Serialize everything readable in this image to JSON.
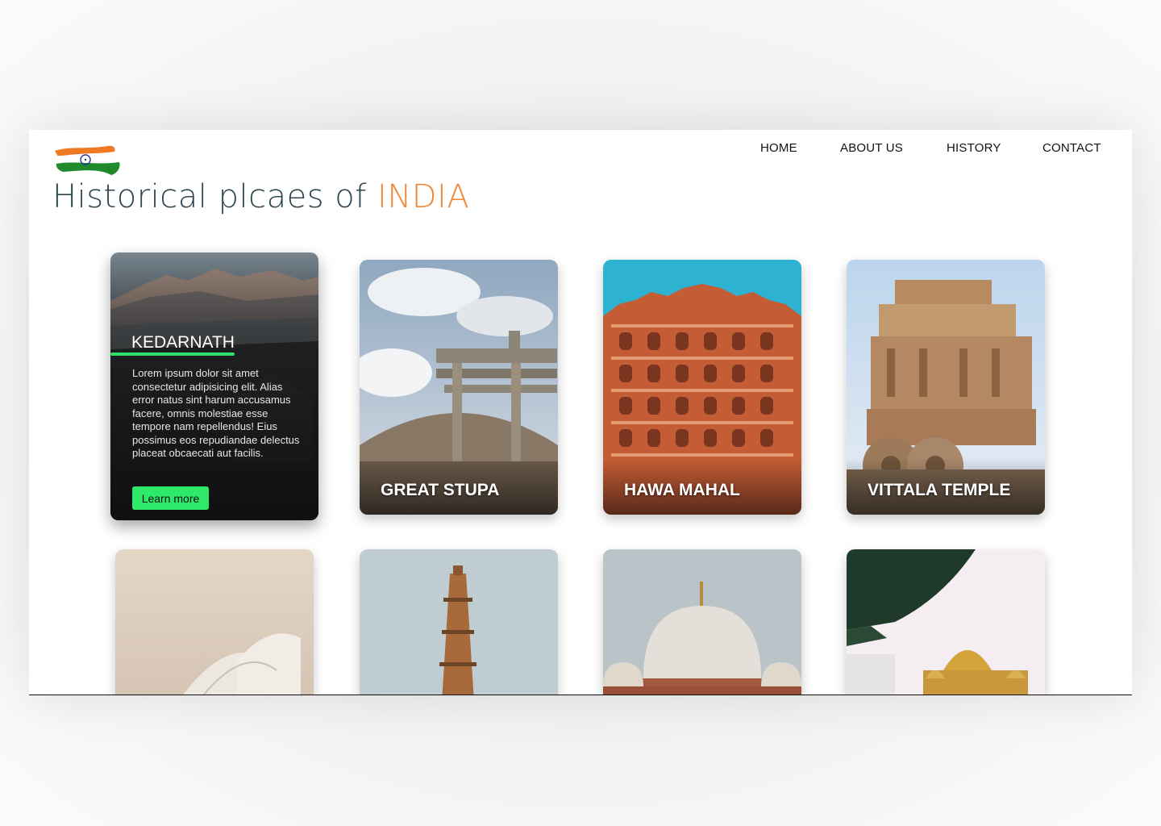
{
  "header": {
    "title_main": "Historical plcaes of ",
    "title_accent": "INDIA",
    "logo": "india-flag-brush-logo"
  },
  "nav": {
    "items": [
      {
        "label": "HOME"
      },
      {
        "label": "ABOUT US"
      },
      {
        "label": "HISTORY"
      },
      {
        "label": "CONTACT"
      }
    ]
  },
  "cards": [
    {
      "name": "KEDARNATH",
      "description": "Lorem ipsum dolor sit amet consectetur adipisicing elit. Alias error natus sint harum accusamus facere, omnis molestiae esse tempore nam repellendus! Eius possimus eos repudiandae delectus placeat obcaecati aut facilis.",
      "button": "Learn more",
      "active": true
    },
    {
      "name": "GREAT STUPA"
    },
    {
      "name": "HAWA MAHAL"
    },
    {
      "name": "VITTALA TEMPLE"
    },
    {
      "name": ""
    },
    {
      "name": ""
    },
    {
      "name": ""
    },
    {
      "name": ""
    }
  ],
  "colors": {
    "title": "#2f4650",
    "accent": "#f0883a",
    "button": "#2ee86a",
    "underline": "#2fe06a"
  }
}
